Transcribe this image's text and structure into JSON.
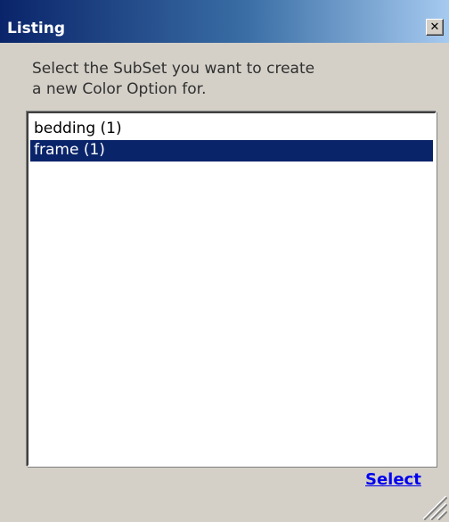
{
  "window": {
    "title": "Listing",
    "close_glyph": "✕"
  },
  "prompt": {
    "line1": "Select the SubSet you want to create",
    "line2": "a new Color Option for."
  },
  "list": {
    "items": [
      {
        "label": "bedding (1)",
        "selected": false
      },
      {
        "label": "frame (1)",
        "selected": true
      }
    ],
    "selected_index": 1
  },
  "actions": {
    "select_label": "Select"
  },
  "colors": {
    "titlebar_start": "#0a246a",
    "titlebar_end": "#a6caf0",
    "selection_bg": "#0a246a",
    "link": "#0000ee",
    "window_bg": "#d4d0c8"
  },
  "icons": {
    "close": "close-icon",
    "resize": "resize-grip-icon"
  }
}
